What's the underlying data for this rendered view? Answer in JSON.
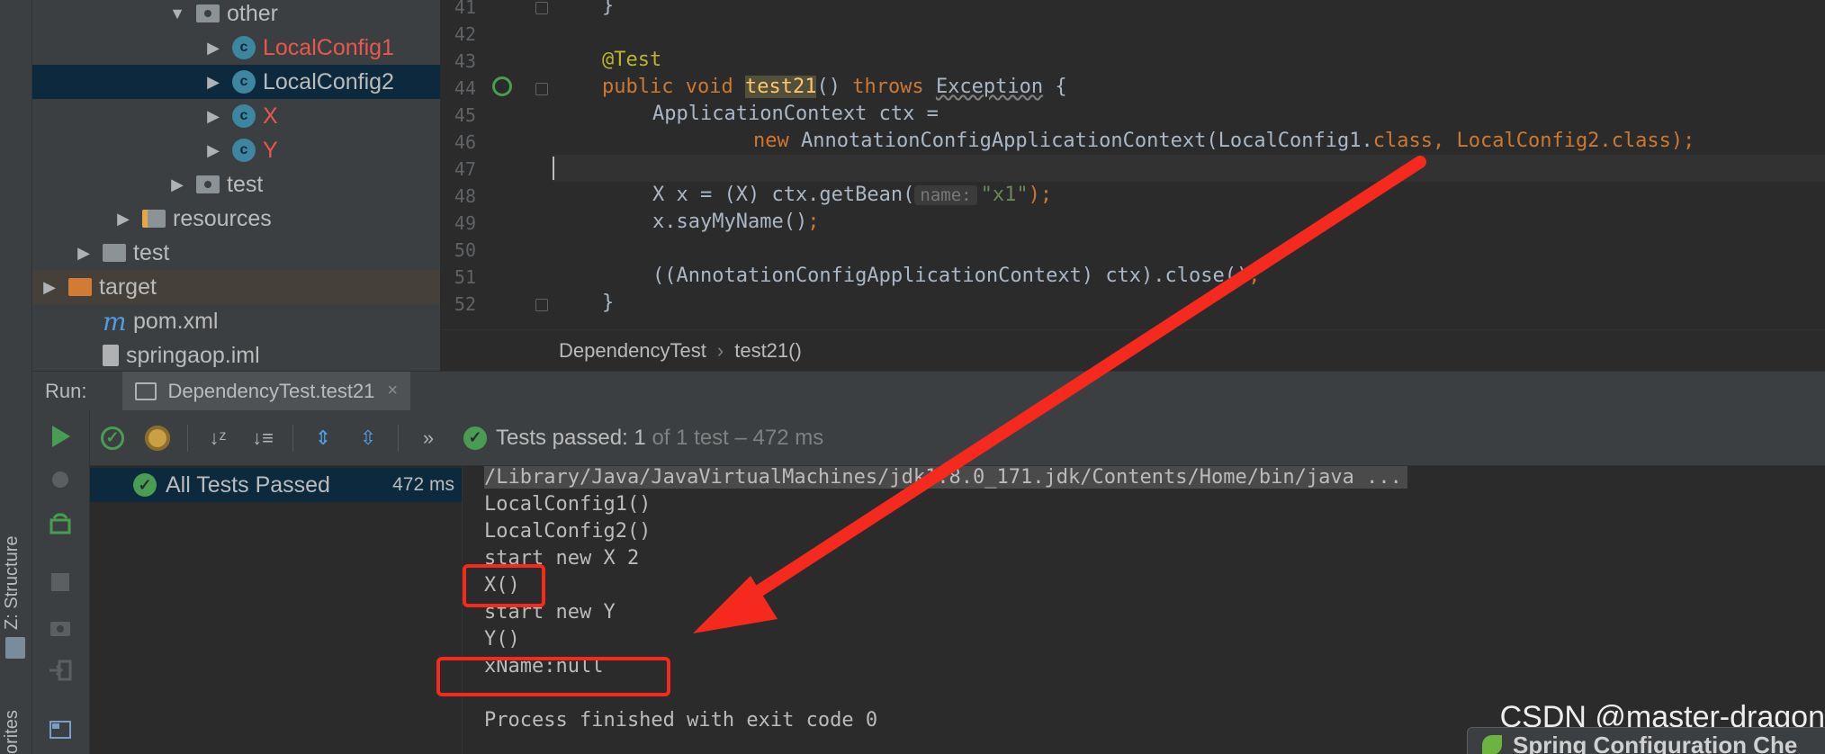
{
  "side_tabs": {
    "structure": "Z: Structure",
    "favorites": "orites"
  },
  "project_tree": {
    "items": [
      {
        "label": "other",
        "arrow": "▼",
        "icon": "package-folder-icon",
        "color": "normal"
      },
      {
        "label": "LocalConfig1",
        "arrow": "▶",
        "icon": "class-icon",
        "color": "red"
      },
      {
        "label": "LocalConfig2",
        "arrow": "▶",
        "icon": "class-icon",
        "color": "normal",
        "selected": true
      },
      {
        "label": "X",
        "arrow": "▶",
        "icon": "class-icon",
        "color": "red"
      },
      {
        "label": "Y",
        "arrow": "▶",
        "icon": "class-icon",
        "color": "red"
      },
      {
        "label": "test",
        "arrow": "▶",
        "icon": "package-folder-icon",
        "color": "normal"
      },
      {
        "label": "resources",
        "arrow": "▶",
        "icon": "resources-folder-icon",
        "color": "normal"
      },
      {
        "label": "test",
        "arrow": "▶",
        "icon": "folder-icon",
        "color": "normal"
      },
      {
        "label": "target",
        "arrow": "▶",
        "icon": "target-folder-icon",
        "color": "normal",
        "highlight": true
      },
      {
        "label": "pom.xml",
        "arrow": "",
        "icon": "maven-icon",
        "color": "normal"
      },
      {
        "label": "springaop.iml",
        "arrow": "",
        "icon": "iml-file-icon",
        "color": "normal"
      }
    ]
  },
  "editor": {
    "line_numbers": [
      "41",
      "42",
      "43",
      "44",
      "45",
      "46",
      "47",
      "48",
      "49",
      "50",
      "51",
      "52"
    ],
    "code": {
      "l41": "}",
      "l43_annotation": "@Test",
      "l44_public": "public",
      "l44_void": "void",
      "l44_method": "test21",
      "l44_parens": "()",
      "l44_throws": "throws",
      "l44_exception": "Exception",
      "l44_brace": "{",
      "l45": "ApplicationContext ctx =",
      "l46_new": "new",
      "l46_ctor": "AnnotationConfigApplicationContext(LocalConfig1.",
      "l46_class1": "class",
      "l46_comma": ", LocalConfig2.",
      "l46_class2": "class",
      "l46_end": ");",
      "l48_decl": "X x = (X) ctx.getBean(",
      "l48_hint": "name:",
      "l48_str": "\"x1\"",
      "l48_end": ");",
      "l49_call": "x.sayMyName()",
      "l49_end": ";",
      "l51_call": "((AnnotationConfigApplicationContext) ctx).close()",
      "l51_end": ";",
      "l52": "}"
    }
  },
  "breadcrumb": {
    "class": "DependencyTest",
    "separator": "›",
    "method": "test21()"
  },
  "run_window": {
    "label": "Run:",
    "tab_label": "DependencyTest.test21",
    "tab_close": "×",
    "status_prefix": "Tests passed:",
    "status_count": "1",
    "status_of": "of 1 test",
    "status_time": "– 472 ms",
    "more": "»"
  },
  "test_tree": {
    "root_label": "All Tests Passed",
    "root_time": "472 ms"
  },
  "console": {
    "lines": [
      "/Library/Java/JavaVirtualMachines/jdk1.8.0_171.jdk/Contents/Home/bin/java ...",
      "LocalConfig1()",
      "LocalConfig2()",
      "start new X 2",
      "X()",
      "start new Y",
      "Y()",
      "xName:null",
      "",
      "Process finished with exit code 0"
    ]
  },
  "watermark": "CSDN @master-dragon",
  "spring_popup": "Spring Configuration Che",
  "colors": {
    "keyword": "#cc7832",
    "annotation": "#bbb529",
    "string": "#6a8759",
    "method_highlight": "#ffc66d",
    "success_green": "#499c54",
    "annotation_red": "#f5291e",
    "unresolved_red": "#e7584f",
    "selection_blue": "#0d293e"
  }
}
